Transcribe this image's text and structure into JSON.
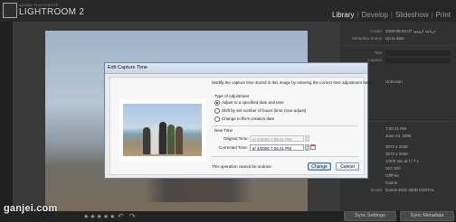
{
  "app": {
    "logo_small": "ADOBE PHOTOSHOP",
    "logo_main": "LIGHTROOM 2"
  },
  "modules": {
    "items": [
      "Library",
      "Develop",
      "Slideshow",
      "Print"
    ],
    "selected": "Library"
  },
  "metadata_panel": {
    "rows": [
      {
        "label": "Folder",
        "value": "2006-06-03 07 دریاچه ارومیه"
      },
      {
        "label": "Metadata Status",
        "value": "Up to date"
      },
      {
        "label": "Title",
        "value": ""
      },
      {
        "label": "Caption",
        "value": ""
      },
      {
        "label": "",
        "value": "Unknown"
      },
      {
        "label": "",
        "value": "7:06:41 PM"
      },
      {
        "label": "",
        "value": "June 04, 2006"
      },
      {
        "label": "",
        "value": "3072 x 2048"
      },
      {
        "label": "",
        "value": "3072 x 2048"
      },
      {
        "label": "",
        "value": "1/200 sec at f / 7.1"
      },
      {
        "label": "",
        "value": "ISO 200"
      },
      {
        "label": "",
        "value": "Off/Fire"
      },
      {
        "label": "",
        "value": "Canon"
      },
      {
        "label": "Model",
        "value": "Canon EOS 300D DIGITAL"
      }
    ]
  },
  "toolbar": {
    "rotate_left": "↶",
    "rotate_right": "↷",
    "stars": "★★★★★"
  },
  "bottom_buttons": {
    "sync_settings": "Sync Settings",
    "sync_metadata": "Sync Metadata"
  },
  "watermark": "ganjei.com",
  "dialog": {
    "title": "Edit Capture Time",
    "description": "Modify the capture time stored in this image by entering the correct time adjustment below.",
    "type_heading": "Type of Adjustment",
    "options": [
      {
        "label": "Adjust to a specified date and time",
        "selected": true
      },
      {
        "label": "Shift by set number of hours (time zone adjust)",
        "selected": false
      },
      {
        "label": "Change to file's creation date",
        "selected": false
      }
    ],
    "new_time_heading": "New Time",
    "original_label": "Original Time:",
    "original_value": "6/ 4/2006  7:06:41 PM",
    "corrected_label": "Corrected Time:",
    "corrected_value": "6/ 4/2006  7:06:41 PM",
    "note": "This operation cannot be undone.",
    "change_button": "Change",
    "cancel_button": "Cancel"
  }
}
